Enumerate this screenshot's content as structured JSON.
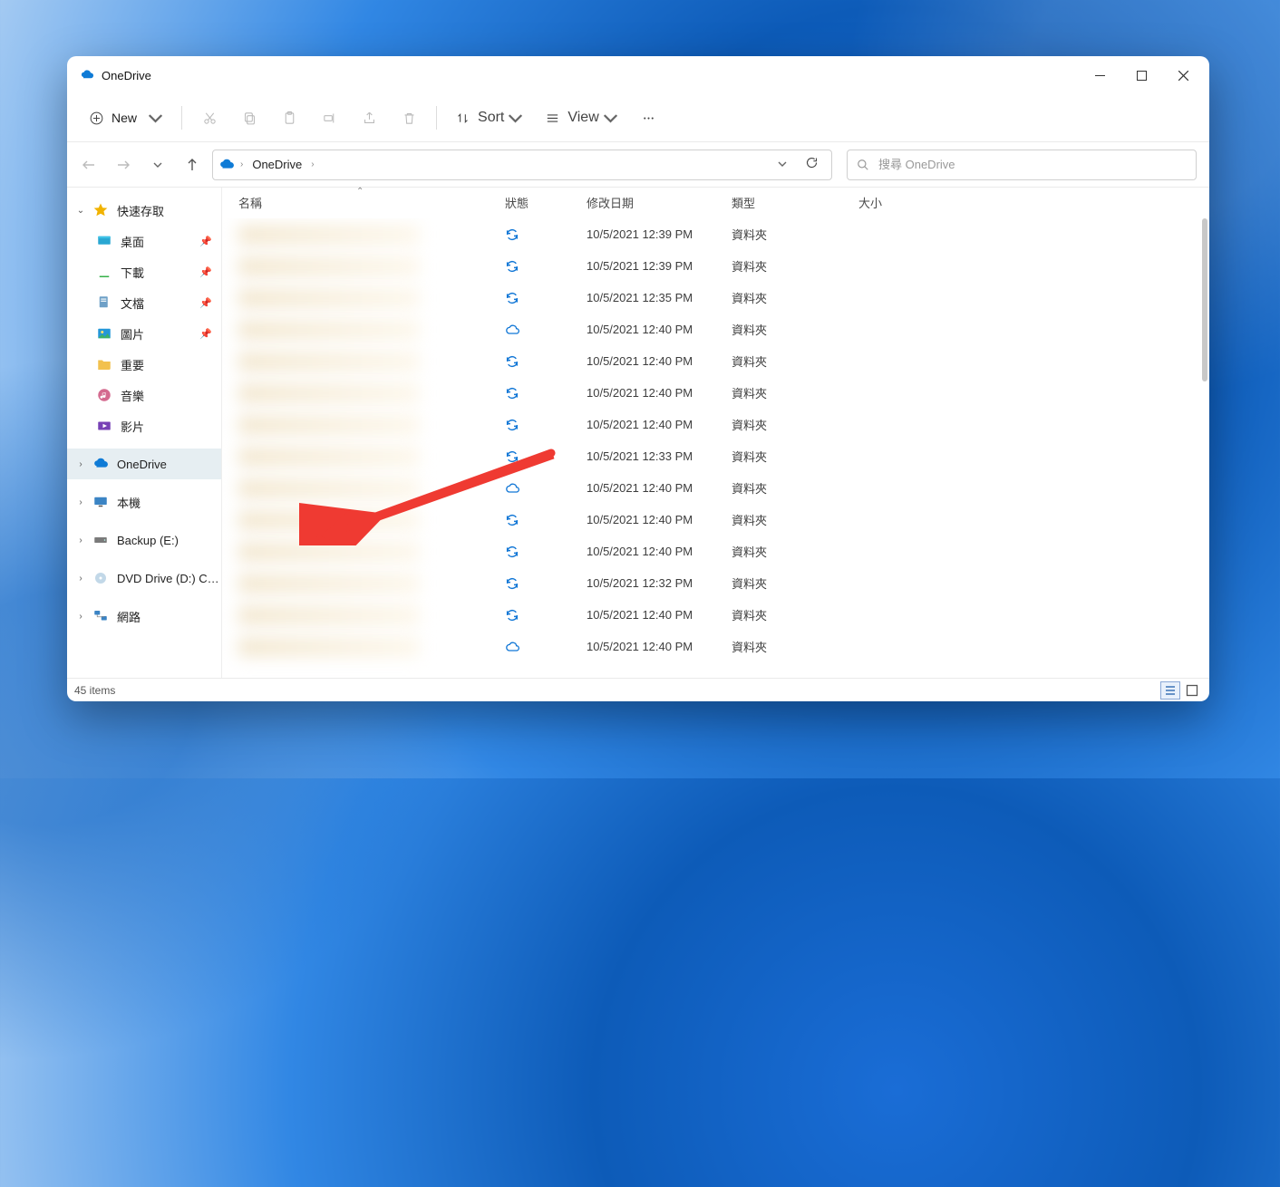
{
  "window": {
    "title": "OneDrive"
  },
  "toolbar": {
    "new_label": "New",
    "sort_label": "Sort",
    "view_label": "View"
  },
  "address": {
    "crumb0": "OneDrive"
  },
  "search": {
    "placeholder": "搜尋 OneDrive"
  },
  "sidebar": {
    "quick_access": "快速存取",
    "desktop": "桌面",
    "downloads": "下載",
    "documents": "文檔",
    "pictures": "圖片",
    "important": "重要",
    "music": "音樂",
    "videos": "影片",
    "onedrive": "OneDrive",
    "this_pc": "本機",
    "backup": "Backup (E:)",
    "dvd": "DVD Drive (D:) CPRA",
    "network": "網路"
  },
  "columns": {
    "name": "名稱",
    "status": "狀態",
    "date": "修改日期",
    "type": "類型",
    "size": "大小"
  },
  "rows": [
    {
      "date": "10/5/2021 12:39 PM",
      "type": "資料夾",
      "status": "sync"
    },
    {
      "date": "10/5/2021 12:39 PM",
      "type": "資料夾",
      "status": "sync"
    },
    {
      "date": "10/5/2021 12:35 PM",
      "type": "資料夾",
      "status": "sync"
    },
    {
      "date": "10/5/2021 12:40 PM",
      "type": "資料夾",
      "status": "cloud"
    },
    {
      "date": "10/5/2021 12:40 PM",
      "type": "資料夾",
      "status": "sync"
    },
    {
      "date": "10/5/2021 12:40 PM",
      "type": "資料夾",
      "status": "sync"
    },
    {
      "date": "10/5/2021 12:40 PM",
      "type": "資料夾",
      "status": "sync"
    },
    {
      "date": "10/5/2021 12:33 PM",
      "type": "資料夾",
      "status": "sync"
    },
    {
      "date": "10/5/2021 12:40 PM",
      "type": "資料夾",
      "status": "cloud"
    },
    {
      "date": "10/5/2021 12:40 PM",
      "type": "資料夾",
      "status": "sync"
    },
    {
      "date": "10/5/2021 12:40 PM",
      "type": "資料夾",
      "status": "sync"
    },
    {
      "date": "10/5/2021 12:32 PM",
      "type": "資料夾",
      "status": "sync"
    },
    {
      "date": "10/5/2021 12:40 PM",
      "type": "資料夾",
      "status": "sync"
    },
    {
      "date": "10/5/2021 12:40 PM",
      "type": "資料夾",
      "status": "cloud"
    }
  ],
  "statusbar": {
    "items": "45 items"
  }
}
